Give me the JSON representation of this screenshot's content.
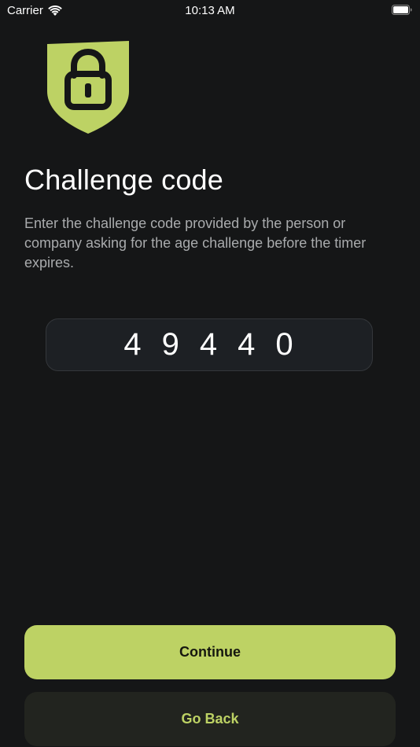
{
  "status_bar": {
    "carrier": "Carrier",
    "time": "10:13 AM",
    "icons": [
      "wifi-icon",
      "battery-icon"
    ]
  },
  "header": {
    "icon": "shield-lock-icon",
    "title": "Challenge code",
    "description": "Enter the challenge code provided by the person or company asking for the age challenge before the timer expires."
  },
  "code": {
    "value": "49440"
  },
  "actions": {
    "continue_label": "Continue",
    "back_label": "Go Back"
  },
  "colors": {
    "background": "#151617",
    "accent": "#bdd264",
    "secondary_button": "#22241f",
    "input_background": "#1d2024",
    "muted_text": "#a9abad"
  }
}
